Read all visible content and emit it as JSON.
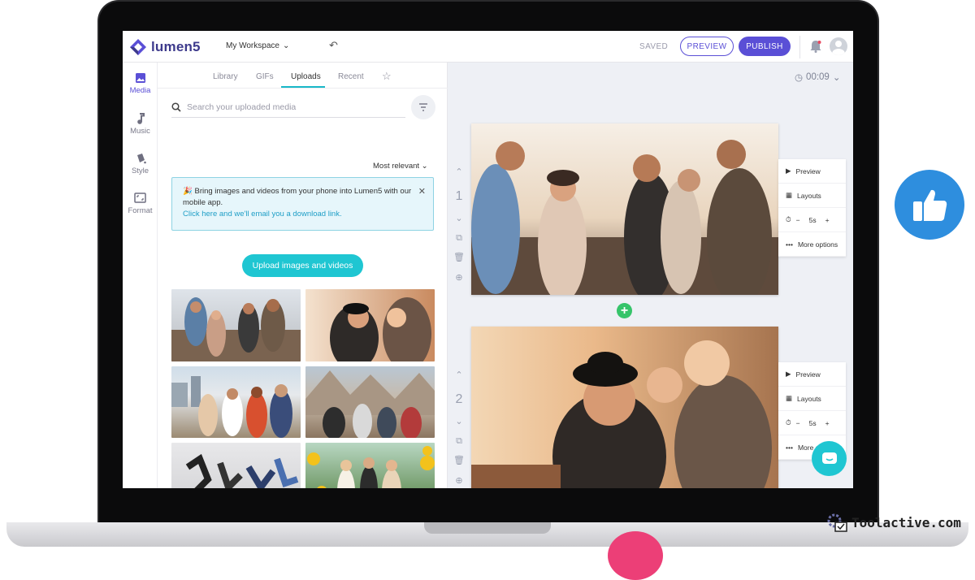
{
  "app": {
    "logo_text": "lumen5",
    "workspace": "My Workspace",
    "saved_status": "SAVED",
    "preview_button": "PREVIEW",
    "publish_button": "PUBLISH",
    "brand_color": "#5a4fd6",
    "accent_color": "#1fc6d2"
  },
  "sidebar": {
    "items": [
      {
        "label": "Media",
        "icon": "image-icon",
        "active": true
      },
      {
        "label": "Music",
        "icon": "music-note-icon"
      },
      {
        "label": "Style",
        "icon": "paint-bucket-icon"
      },
      {
        "label": "Format",
        "icon": "aspect-ratio-icon"
      }
    ]
  },
  "media_panel": {
    "tabs": [
      "Library",
      "GIFs",
      "Uploads",
      "Recent"
    ],
    "active_tab": "Uploads",
    "favorites_icon": "star-icon",
    "search_placeholder": "Search your uploaded media",
    "sort_label": "Most relevant",
    "notice": {
      "text": "Bring images and videos from your phone into Lumen5 with our mobile app.",
      "link": "Click here and we'll email you a download link."
    },
    "upload_button": "Upload images and videos"
  },
  "canvas": {
    "duration": "00:09",
    "slides": [
      {
        "number": "1",
        "menu": {
          "preview": "Preview",
          "layouts": "Layouts",
          "duration": "5s",
          "minus": "−",
          "plus": "+",
          "more": "More options"
        }
      },
      {
        "number": "2",
        "menu": {
          "preview": "Preview",
          "layouts": "Layouts",
          "duration": "5s",
          "minus": "−",
          "plus": "+",
          "more": "More options"
        }
      }
    ]
  },
  "watermark": "Toolactive.com"
}
